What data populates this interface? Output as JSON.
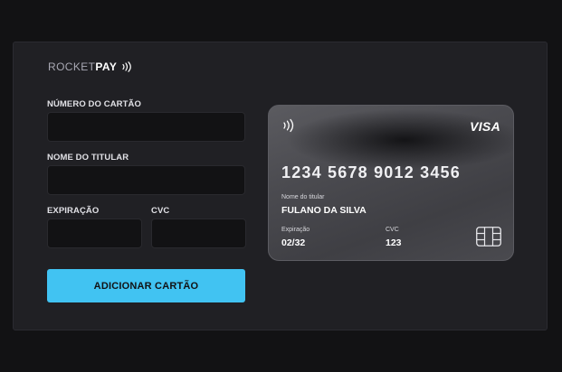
{
  "brand": {
    "name_light": "ROCKET",
    "name_bold": "PAY",
    "icon": "contactless-icon"
  },
  "form": {
    "number_label": "NÚMERO DO CARTÃO",
    "number_value": "",
    "name_label": "NOME DO TITULAR",
    "name_value": "",
    "expiry_label": "EXPIRAÇÃO",
    "expiry_value": "",
    "cvc_label": "CVC",
    "cvc_value": "",
    "submit_label": "ADICIONAR CARTÃO"
  },
  "card": {
    "contactless_icon": "contactless-icon",
    "network": "VISA",
    "number": "1234 5678 9012 3456",
    "holder_caption": "Nome do titular",
    "holder_name": "FULANO DA SILVA",
    "expiry_caption": "Expiração",
    "expiry_value": "02/32",
    "cvc_caption": "CVC",
    "cvc_value": "123",
    "chip_icon": "chip-icon"
  },
  "colors": {
    "background": "#121214",
    "panel": "#202024",
    "accent": "#41c3f2",
    "text": "#e1e1e6"
  }
}
